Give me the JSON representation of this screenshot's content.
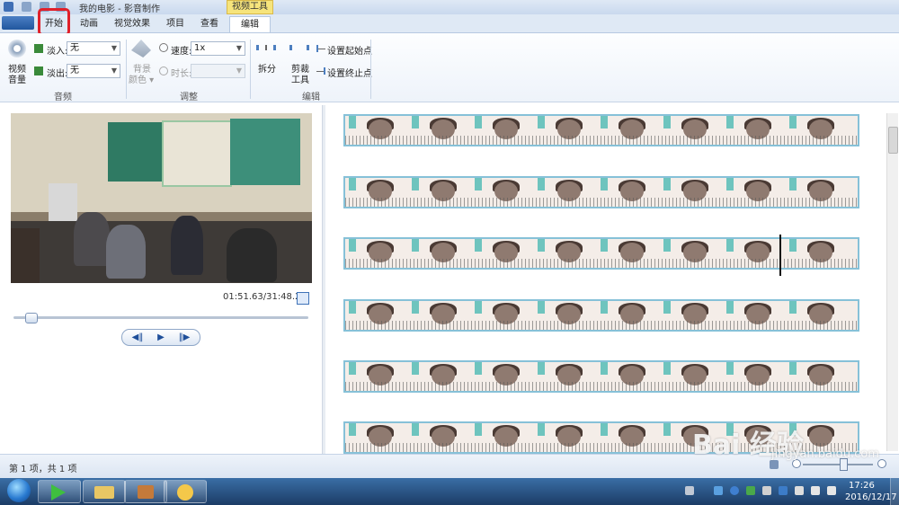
{
  "window": {
    "title": "我的电影 - 影音制作",
    "context_tab_label": "视频工具"
  },
  "tabs": [
    {
      "label": "开始",
      "highlighted": true
    },
    {
      "label": "动画"
    },
    {
      "label": "视觉效果"
    },
    {
      "label": "项目"
    },
    {
      "label": "查看"
    },
    {
      "label": "编辑",
      "active": true
    }
  ],
  "ribbon": {
    "audio": {
      "volume_label_1": "视频",
      "volume_label_2": "音量",
      "fade_in_label": "淡入:",
      "fade_in_value": "无",
      "fade_out_label": "淡出:",
      "fade_out_value": "无",
      "group_label": "音频"
    },
    "adjust": {
      "bg_color_label_1": "背景",
      "bg_color_label_2": "颜色 ▾",
      "speed_label": "速度:",
      "speed_value": "1x",
      "duration_label": "时长:",
      "duration_value": "",
      "group_label": "调整"
    },
    "edit": {
      "split_label": "拆分",
      "trim_label_1": "剪裁",
      "trim_label_2": "工具",
      "set_start_label": "设置起始点",
      "set_end_label": "设置终止点",
      "group_label": "编辑"
    }
  },
  "preview": {
    "timecode": "01:51.63/31:48.27",
    "progress_fraction": 0.059
  },
  "playback": {
    "prev_icon": "◀‖",
    "play_icon": "▶",
    "next_icon": "‖▶"
  },
  "storyboard": {
    "strip_count": 6
  },
  "status": {
    "item_count": "第 1 项，共 1 项"
  },
  "taskbar": {
    "time": "17:26",
    "date": "2016/12/17"
  },
  "watermark": {
    "main": "Bai 经验",
    "sub": "jingyan.baidu.com"
  },
  "colors": {
    "highlight_box": "#e0202a",
    "strip_border": "#86c1d8",
    "context_tab": "#f6e47c"
  }
}
